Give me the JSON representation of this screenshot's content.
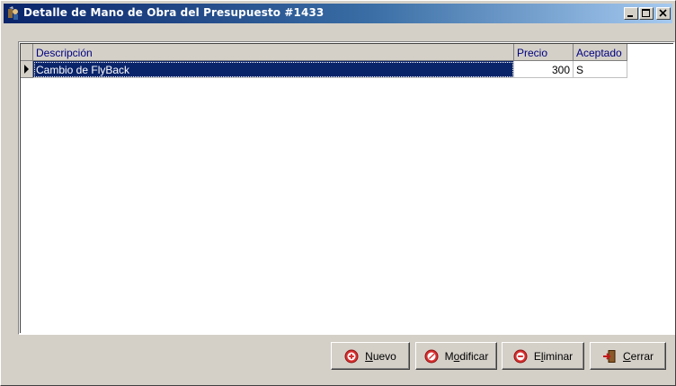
{
  "window": {
    "title": "Detalle de Mano de Obra del Presupuesto #1433",
    "icon": "app-icon",
    "controls": [
      "minimize-icon",
      "maximize-icon",
      "close-icon"
    ]
  },
  "grid": {
    "columns": [
      "Descripción",
      "Precio",
      "Aceptado"
    ],
    "rows": [
      {
        "descripcion": "Cambio de FlyBack",
        "precio": "300",
        "aceptado": "S"
      }
    ]
  },
  "buttons": {
    "nuevo": {
      "label": "Nuevo",
      "mnemonic": "N",
      "icon": "plus-circle-icon"
    },
    "modificar": {
      "label": "Modificar",
      "mnemonic": "o",
      "icon": "edit-circle-icon"
    },
    "eliminar": {
      "label": "Eliminar",
      "mnemonic": "l",
      "icon": "minus-circle-icon"
    },
    "cerrar": {
      "label": "Cerrar",
      "mnemonic": "C",
      "icon": "exit-door-icon"
    }
  },
  "colors": {
    "title_start": "#0a246a",
    "title_end": "#a6caf0",
    "selection": "#0a246a",
    "header_text": "#000080",
    "face": "#d4d0c8",
    "button_icon": "#cc2222"
  }
}
